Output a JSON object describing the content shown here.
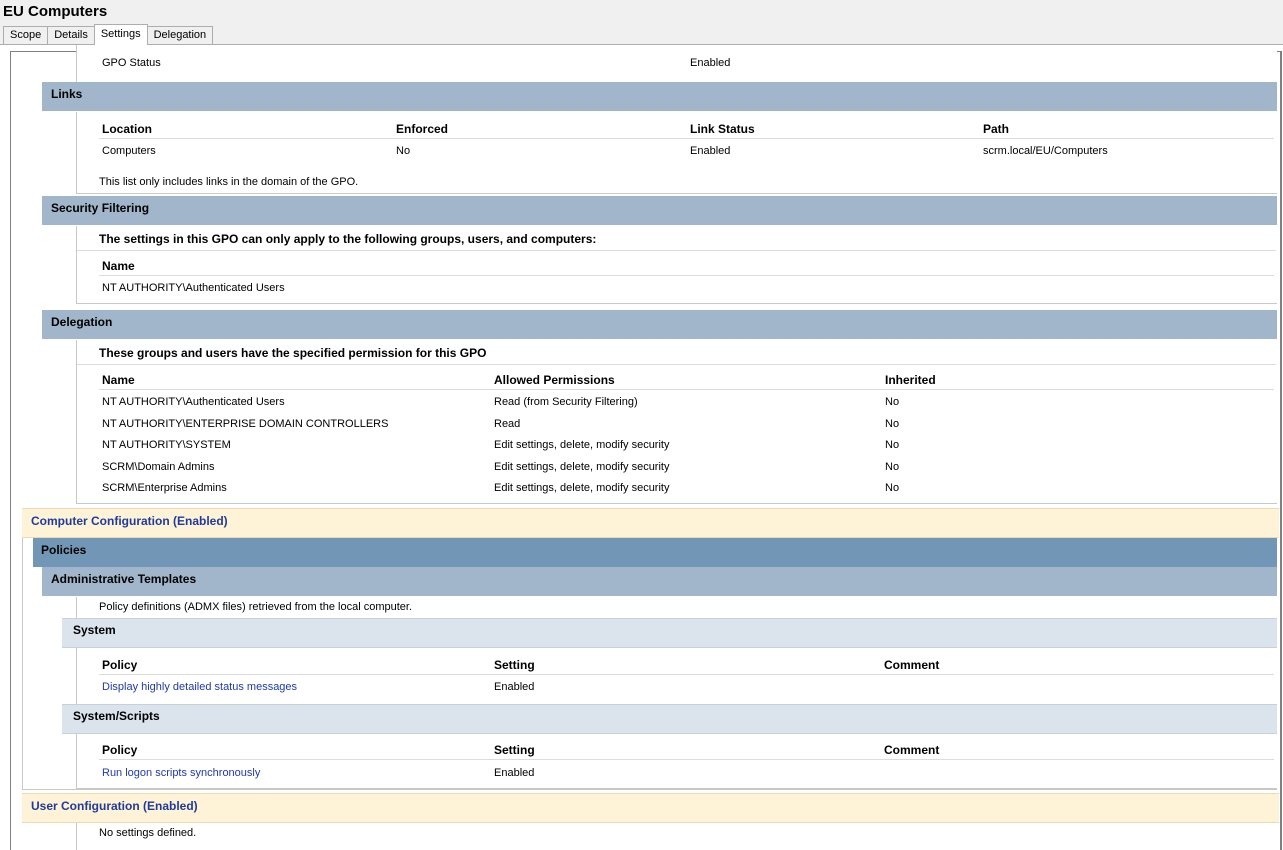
{
  "window": {
    "title": "EU Computers"
  },
  "tabs": [
    "Scope",
    "Details",
    "Settings",
    "Delegation"
  ],
  "gpo_status": {
    "label": "GPO Status",
    "value": "Enabled"
  },
  "links": {
    "title": "Links",
    "headers": [
      "Location",
      "Enforced",
      "Link Status",
      "Path"
    ],
    "row": [
      "Computers",
      "No",
      "Enabled",
      "scrm.local/EU/Computers"
    ],
    "note": "This list only includes links in the domain of the GPO."
  },
  "security_filtering": {
    "title": "Security Filtering",
    "description": "The settings in this GPO can only apply to the following groups, users, and computers:",
    "header": "Name",
    "row": "NT AUTHORITY\\Authenticated Users"
  },
  "delegation": {
    "title": "Delegation",
    "description": "These groups and users have the specified permission for this GPO",
    "headers": [
      "Name",
      "Allowed Permissions",
      "Inherited"
    ],
    "rows": [
      [
        "NT AUTHORITY\\Authenticated Users",
        "Read (from Security Filtering)",
        "No"
      ],
      [
        "NT AUTHORITY\\ENTERPRISE DOMAIN CONTROLLERS",
        "Read",
        "No"
      ],
      [
        "NT AUTHORITY\\SYSTEM",
        "Edit settings, delete, modify security",
        "No"
      ],
      [
        "SCRM\\Domain Admins",
        "Edit settings, delete, modify security",
        "No"
      ],
      [
        "SCRM\\Enterprise Admins",
        "Edit settings, delete, modify security",
        "No"
      ]
    ]
  },
  "computer_config": {
    "title": "Computer Configuration (Enabled)",
    "policies": "Policies",
    "admin_templates": "Administrative Templates",
    "admin_note": "Policy definitions (ADMX files) retrieved from the local computer.",
    "system": {
      "title": "System",
      "headers": [
        "Policy",
        "Setting",
        "Comment"
      ],
      "row": [
        "Display highly detailed status messages",
        "Enabled",
        ""
      ]
    },
    "system_scripts": {
      "title": "System/Scripts",
      "headers": [
        "Policy",
        "Setting",
        "Comment"
      ],
      "row": [
        "Run logon scripts synchronously",
        "Enabled",
        ""
      ]
    }
  },
  "user_config": {
    "title": "User Configuration (Enabled)",
    "note": "No settings defined."
  },
  "colors": {
    "section_header": "#a1b6cb",
    "policies_header": "#7297b6",
    "sub_header": "#dbe3ec",
    "config_header": "#fef3d6",
    "link_blue": "#1f3aa8"
  }
}
